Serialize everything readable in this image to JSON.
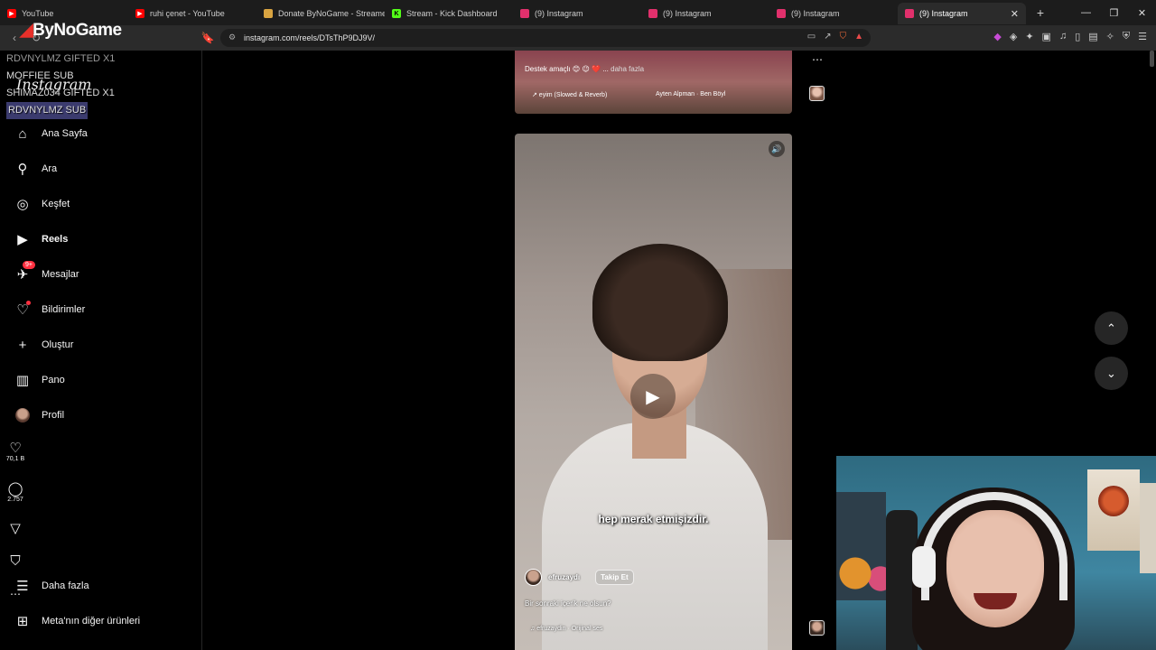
{
  "browser": {
    "tabs": [
      {
        "title": "YouTube",
        "icon": "youtube-icon",
        "color": "#ff0000",
        "active": false
      },
      {
        "title": "ruhi çenet - YouTube",
        "icon": "youtube-icon",
        "color": "#ff0000",
        "active": false
      },
      {
        "title": "Donate ByNoGame - Streamer",
        "icon": "bynogame-icon",
        "color": "#d9a441",
        "active": false
      },
      {
        "title": "Stream - Kick Dashboard",
        "icon": "kick-icon",
        "color": "#53fc18",
        "active": false
      },
      {
        "title": "(9) Instagram",
        "icon": "instagram-icon",
        "color": "#e1306c",
        "active": false
      },
      {
        "title": "(9) Instagram",
        "icon": "instagram-icon",
        "color": "#e1306c",
        "active": false
      },
      {
        "title": "(9) Instagram",
        "icon": "instagram-icon",
        "color": "#e1306c",
        "active": false
      },
      {
        "title": "(9) Instagram",
        "icon": "instagram-icon",
        "color": "#e1306c",
        "active": true
      }
    ],
    "url": "instagram.com/reels/DTsThP9DJ9V/"
  },
  "overlay": {
    "brand": "ByNoGame",
    "alerts": [
      {
        "text": "RDVNYLMZ  GIFTED X1",
        "style": "faded"
      },
      {
        "text": "MOFFIEE  SUB",
        "style": "normal"
      },
      {
        "text": "SHIMAZ034  GIFTED X1",
        "style": "normal"
      },
      {
        "text": "RDVNYLMZ  SUB",
        "style": "hl"
      }
    ]
  },
  "sidebar": {
    "logo": "Instagram",
    "items": [
      {
        "label": "Ana Sayfa",
        "icon": "home-icon"
      },
      {
        "label": "Ara",
        "icon": "search-icon"
      },
      {
        "label": "Keşfet",
        "icon": "compass-icon"
      },
      {
        "label": "Reels",
        "icon": "reels-icon"
      },
      {
        "label": "Mesajlar",
        "icon": "messenger-icon",
        "badge": "9+"
      },
      {
        "label": "Bildirimler",
        "icon": "heart-icon"
      },
      {
        "label": "Oluştur",
        "icon": "plus-icon"
      },
      {
        "label": "Pano",
        "icon": "chart-icon"
      },
      {
        "label": "Profil",
        "icon": "avatar"
      }
    ],
    "more": "Daha fazla",
    "meta": "Meta'nın diğer ürünleri"
  },
  "previous_reel": {
    "caption": "Destek amaçlı 😊 😉 ❤️ ...",
    "more": "daha fazla",
    "music_1": "↗ eyim (Slowed & Reverb)",
    "music_2": "Ayten Alpman · Ben Böyl"
  },
  "reel": {
    "subtitle": "hep merak etmişizdir.",
    "author": "efruzaydı",
    "follow": "Takip Et",
    "caption": "Bir sonraki içerik ne olsun?",
    "audio": "♫ efruzaydin · Orijinal ses",
    "likes": "70,1 B",
    "comments": "2.757"
  }
}
